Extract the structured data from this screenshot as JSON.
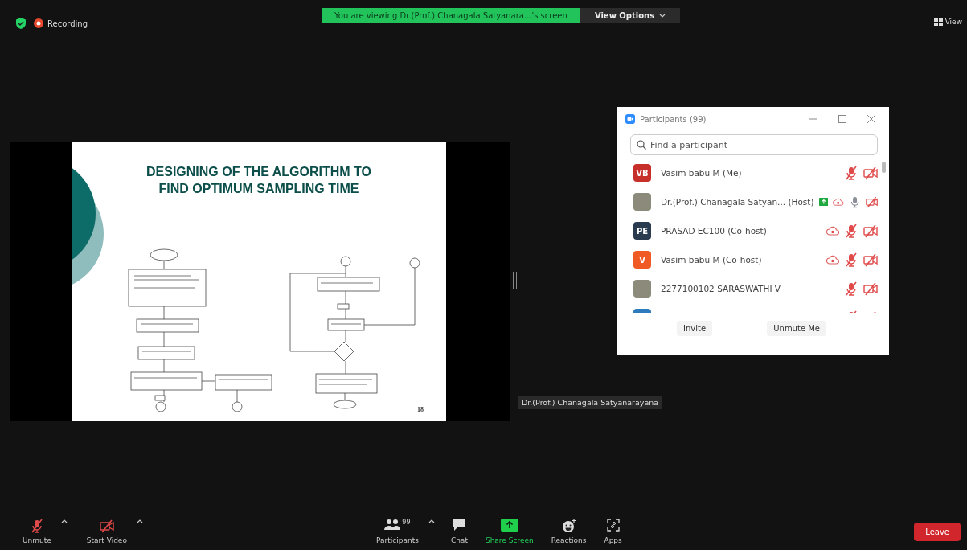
{
  "top_bar": {
    "recording_label": "Recording",
    "viewing_banner": "You are viewing Dr.(Prof.) Chanagala Satyanara...'s screen",
    "view_options": "View Options",
    "view": "View"
  },
  "shared_screen": {
    "slide": {
      "title_lines": [
        "DESIGNING OF THE ALGORITHM TO",
        "FIND OPTIMUM SAMPLING TIME"
      ],
      "page_number": "18"
    },
    "presenter_name": "Dr.(Prof.) Chanagala Satyanarayana"
  },
  "participants_panel": {
    "title": "Participants (99)",
    "search": {
      "placeholder": "Find a participant"
    },
    "participants": [
      {
        "avatar": {
          "kind": "initials",
          "initials": "VB",
          "color": "#c62f2a"
        },
        "name": "Vasim babu M (Me)",
        "sharing": false,
        "recording": false,
        "muted": true
      },
      {
        "avatar": {
          "kind": "photo"
        },
        "name": "Dr.(Prof.) Chanagala Satyan... (Host)",
        "sharing": true,
        "recording": true,
        "muted": false
      },
      {
        "avatar": {
          "kind": "initials",
          "initials": "PE",
          "color": "#2a3a4f"
        },
        "name": "PRASAD EC100 (Co-host)",
        "sharing": false,
        "recording": true,
        "muted": true
      },
      {
        "avatar": {
          "kind": "initials",
          "initials": "V",
          "color": "#f05a24"
        },
        "name": "Vasim babu M (Co-host)",
        "sharing": false,
        "recording": true,
        "muted": true
      },
      {
        "avatar": {
          "kind": "photo"
        },
        "name": "2277100102 SARASWATHI V",
        "sharing": false,
        "recording": false,
        "muted": true
      },
      {
        "avatar": {
          "kind": "initials",
          "color": "#2d7bbf"
        },
        "sharing": false,
        "recording": false,
        "muted": true
      }
    ],
    "buttons": [
      "Invite",
      "Unmute Me"
    ]
  },
  "toolbar": {
    "left": [
      {
        "kind": "mic",
        "label": "Unmute"
      },
      {
        "kind": "video",
        "label": "Start Video"
      }
    ],
    "center": [
      {
        "kind": "participants",
        "label": "Participants",
        "count": "99"
      },
      {
        "kind": "chat",
        "label": "Chat"
      },
      {
        "kind": "share",
        "label": "Share Screen"
      },
      {
        "kind": "reactions",
        "label": "Reactions"
      },
      {
        "kind": "apps",
        "label": "Apps"
      }
    ],
    "leave": "Leave"
  }
}
